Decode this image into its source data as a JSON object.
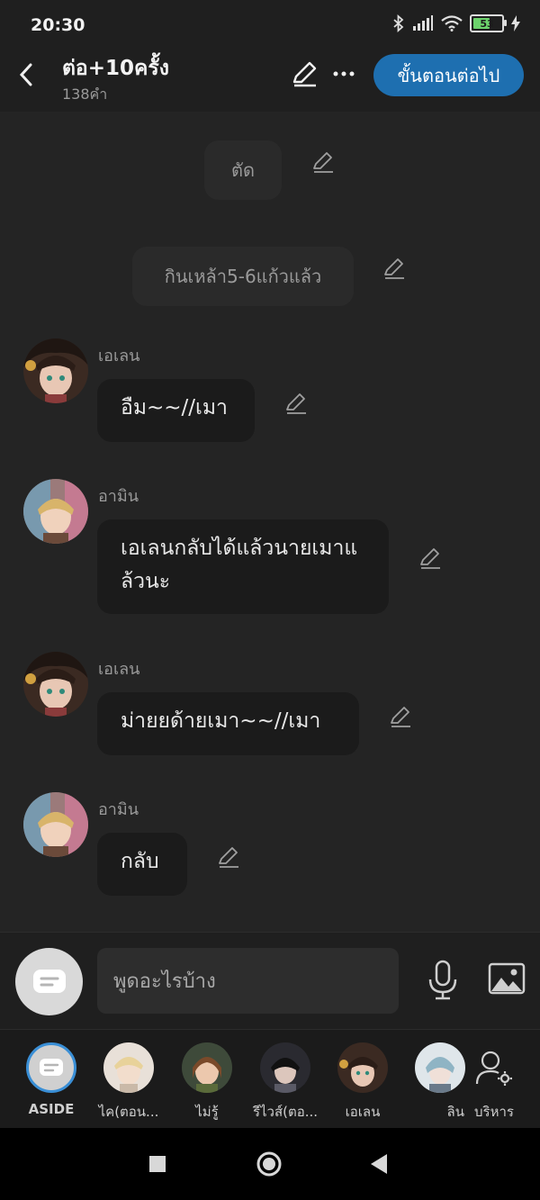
{
  "status_bar": {
    "time": "20:30",
    "battery": "53"
  },
  "header": {
    "title": "ต่อ+10ครั้ง",
    "subtitle": "138คำ",
    "next_button": "ขั้นตอนต่อไป"
  },
  "messages": [
    {
      "type": "narration",
      "text": "ตัด"
    },
    {
      "type": "narration",
      "text": "กินเหล้า5-6แก้วแล้ว"
    },
    {
      "type": "dialogue",
      "speaker": "เอเลน",
      "text": "อืม~~//เมา"
    },
    {
      "type": "dialogue",
      "speaker": "อามิน",
      "text": "เอเลนกลับได้แล้วนายเมาแล้วนะ"
    },
    {
      "type": "dialogue",
      "speaker": "เอเลน",
      "text": "ม่ายยด้ายเมา~~//เมา"
    },
    {
      "type": "dialogue",
      "speaker": "อามิน",
      "text": "กลับ"
    }
  ],
  "input": {
    "placeholder": "พูดอะไรบ้าง"
  },
  "characters": [
    {
      "label": "ASIDE"
    },
    {
      "label": "ไค(ตอน..."
    },
    {
      "label": "ไม่รู้"
    },
    {
      "label": "รีไวส์(ตอ..."
    },
    {
      "label": "เอเลน"
    },
    {
      "label": "ลิน"
    },
    {
      "label": "บริหาร"
    }
  ],
  "colors": {
    "accent": "#1e6fb0",
    "background": "#242424",
    "bubble": "#1b1b1b"
  },
  "icons": [
    "back-arrow-icon",
    "edit-pencil-icon",
    "more-dots-icon",
    "chat-bubble-icon",
    "microphone-icon",
    "image-icon",
    "manage-user-gear-icon",
    "square-nav-icon",
    "circle-nav-icon",
    "triangle-back-nav-icon"
  ]
}
